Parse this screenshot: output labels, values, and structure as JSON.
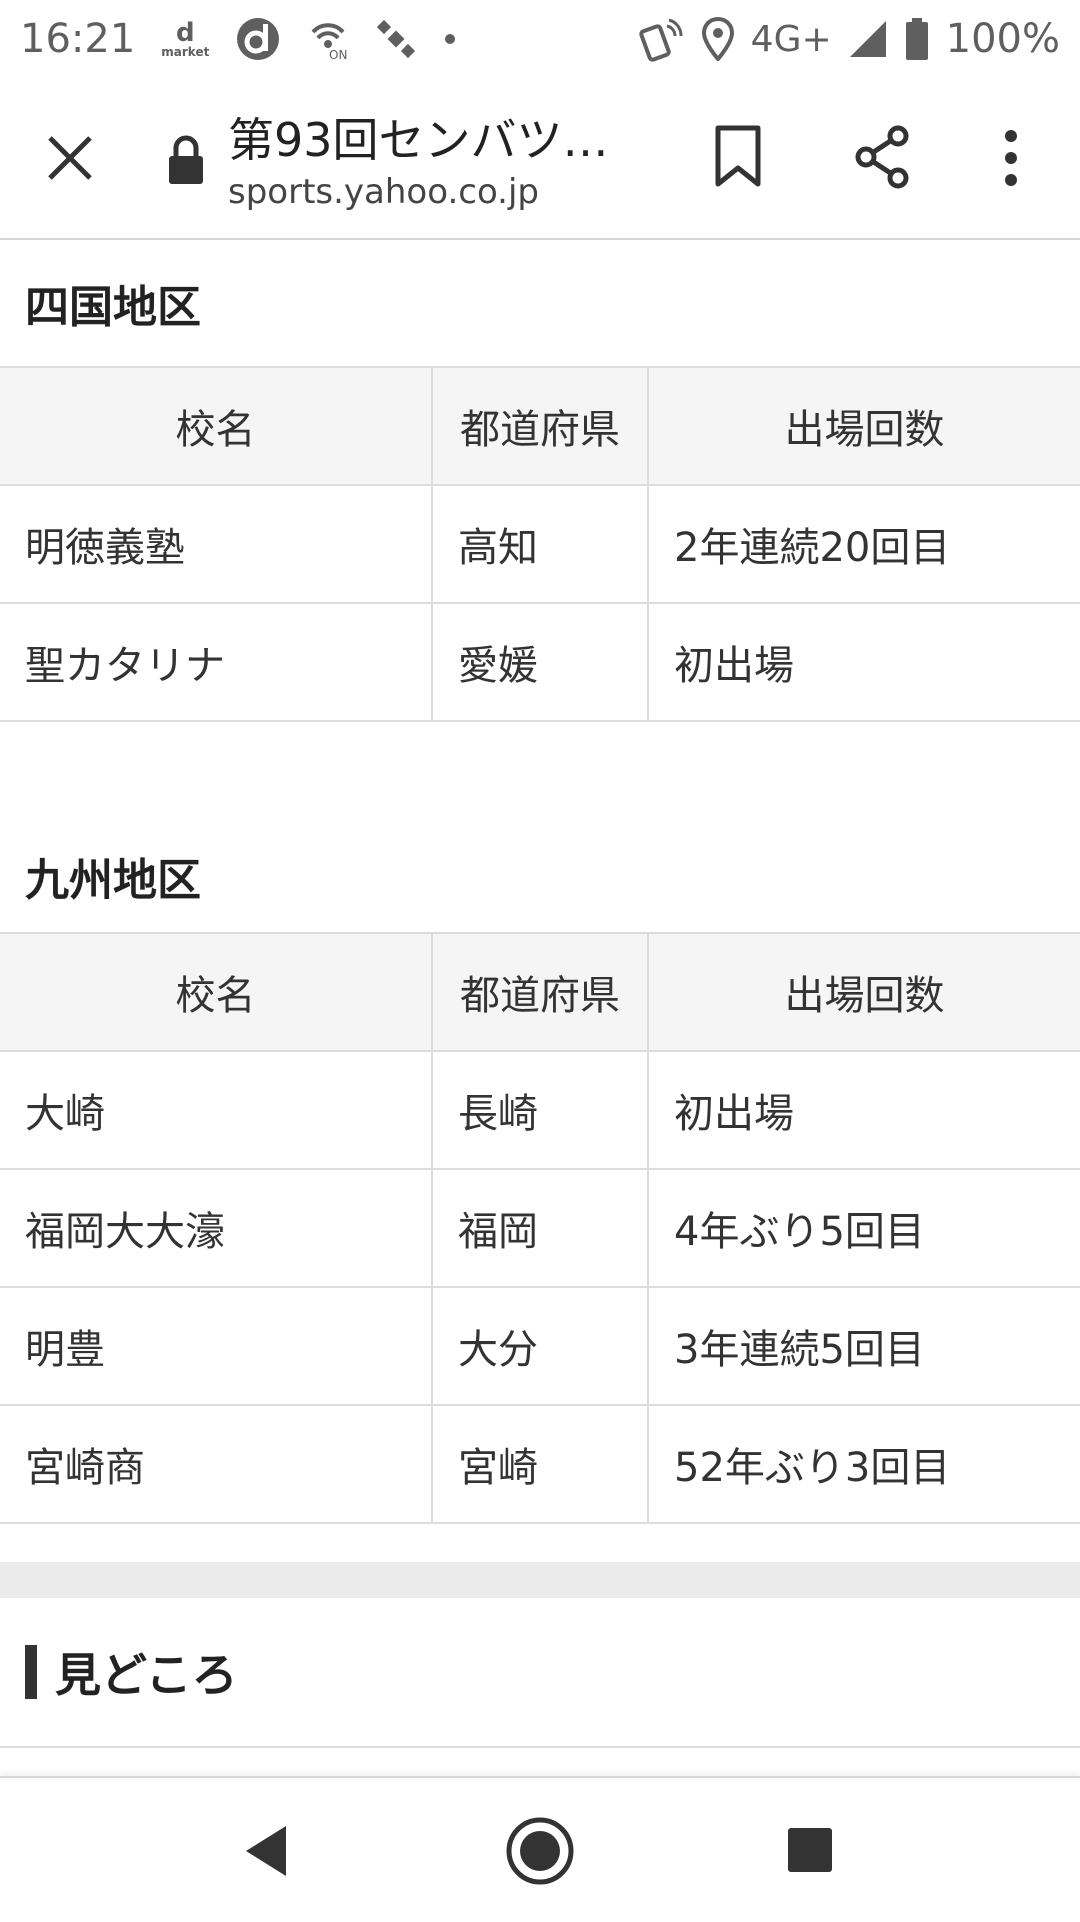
{
  "status_bar": {
    "time": "16:21",
    "dmarket_letter": "d",
    "dmarket_sub": "market",
    "network_label": "4G+",
    "battery": "100%",
    "icons": [
      "dmarket-icon",
      "d-app-icon",
      "wifi-calling-icon",
      "satellite-icon",
      "dot-icon",
      "nfc-icon",
      "location-icon",
      "signal-icon",
      "battery-icon"
    ]
  },
  "toolbar": {
    "title": "第93回センバツ…",
    "url": "sports.yahoo.co.jp",
    "icons": [
      "close-icon",
      "lock-icon",
      "bookmark-icon",
      "share-icon",
      "more-vert-icon"
    ]
  },
  "tables": {
    "headers": [
      "校名",
      "都道府県",
      "出場回数"
    ],
    "shikoku": {
      "title": "四国地区",
      "rows": [
        [
          "明徳義塾",
          "高知",
          "2年連続20回目"
        ],
        [
          "聖カタリナ",
          "愛媛",
          "初出場"
        ]
      ]
    },
    "kyushu": {
      "title": "九州地区",
      "rows": [
        [
          "大崎",
          "長崎",
          "初出場"
        ],
        [
          "福岡大大濠",
          "福岡",
          "4年ぶり5回目"
        ],
        [
          "明豊",
          "大分",
          "3年連続5回目"
        ],
        [
          "宮崎商",
          "宮崎",
          "52年ぶり3回目"
        ]
      ]
    }
  },
  "highlight": {
    "title": "見どころ"
  },
  "nav_bar": {
    "icons": [
      "back-icon",
      "home-icon",
      "recents-icon"
    ]
  },
  "colors": {
    "text": "#222222",
    "icon_gray": "#5f5f5f",
    "header_bg": "#f5f5f5",
    "border": "#dddddd",
    "band": "#ebebeb"
  }
}
